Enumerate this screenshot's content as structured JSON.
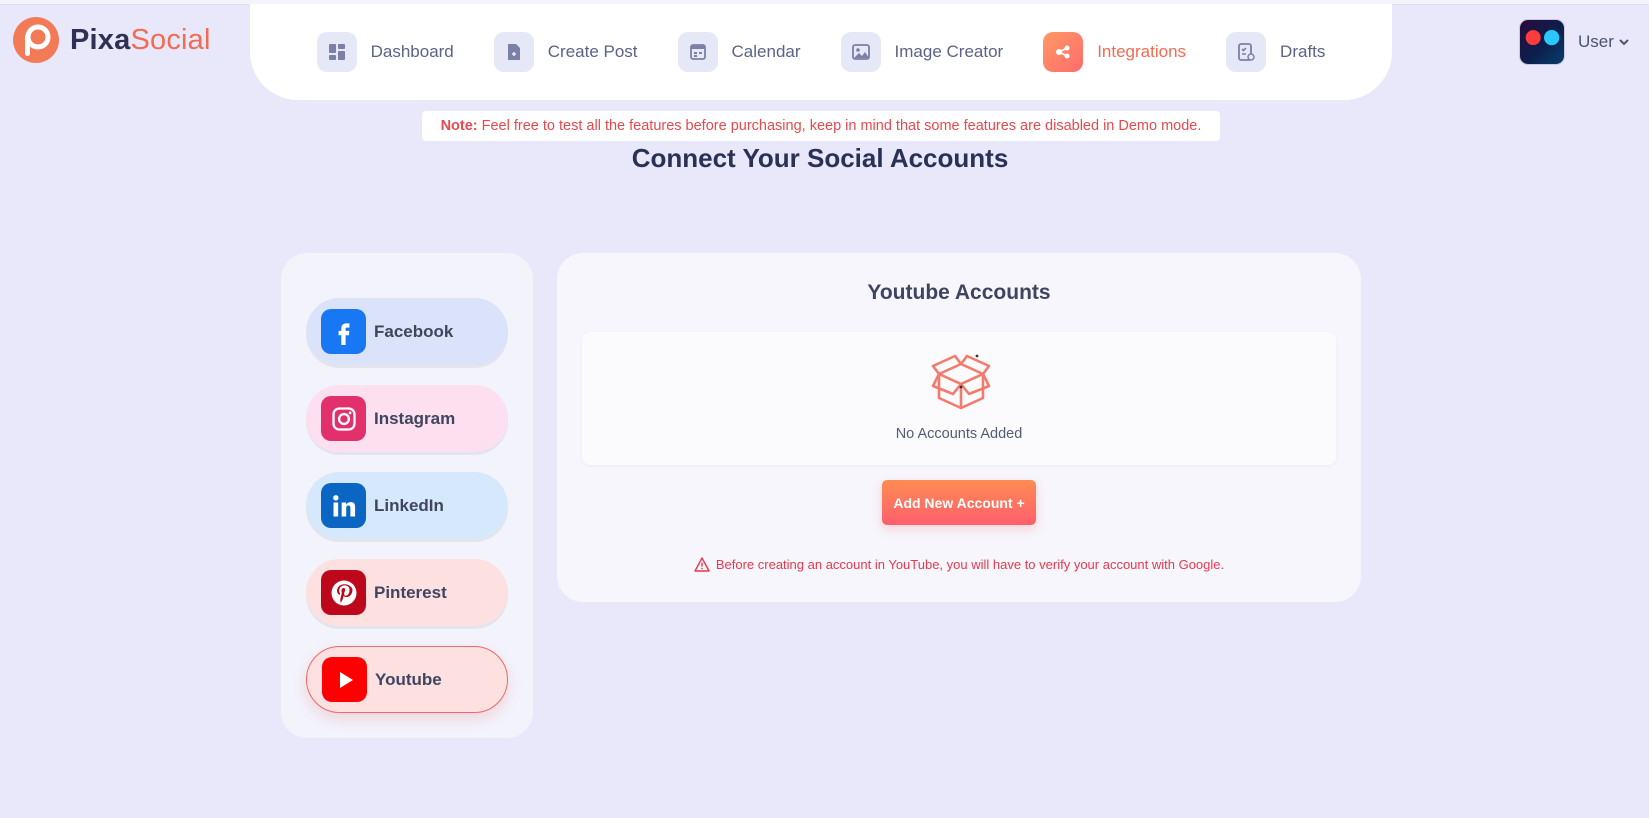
{
  "brand": {
    "name_part1": "Pixa",
    "name_part2": "Social",
    "accent": "#f26b52"
  },
  "nav": {
    "items": [
      {
        "label": "Dashboard",
        "icon": "dashboard-icon",
        "active": false
      },
      {
        "label": "Create Post",
        "icon": "create-post-icon",
        "active": false
      },
      {
        "label": "Calendar",
        "icon": "calendar-icon",
        "active": false
      },
      {
        "label": "Image Creator",
        "icon": "image-icon",
        "active": false
      },
      {
        "label": "Integrations",
        "icon": "integrations-icon",
        "active": true
      },
      {
        "label": "Drafts",
        "icon": "drafts-icon",
        "active": false
      }
    ]
  },
  "user": {
    "label": "User"
  },
  "note": {
    "prefix": "Note:",
    "text": "Feel free to test all the features before purchasing, keep in mind that some features are disabled in Demo mode."
  },
  "page": {
    "title": "Connect Your Social Accounts"
  },
  "platforms": [
    {
      "label": "Facebook",
      "icon": "facebook-icon",
      "color": "#1877f2"
    },
    {
      "label": "Instagram",
      "icon": "instagram-icon",
      "color": "#e1306c"
    },
    {
      "label": "LinkedIn",
      "icon": "linkedin-icon",
      "color": "#0a66c2"
    },
    {
      "label": "Pinterest",
      "icon": "pinterest-icon",
      "color": "#bd081c"
    },
    {
      "label": "Youtube",
      "icon": "youtube-icon",
      "color": "#ff0000",
      "selected": true
    }
  ],
  "panel": {
    "title": "Youtube Accounts",
    "empty_text": "No Accounts Added",
    "add_button": "Add New Account +",
    "warning": "Before creating an account in YouTube, you will have to verify your account with Google."
  }
}
